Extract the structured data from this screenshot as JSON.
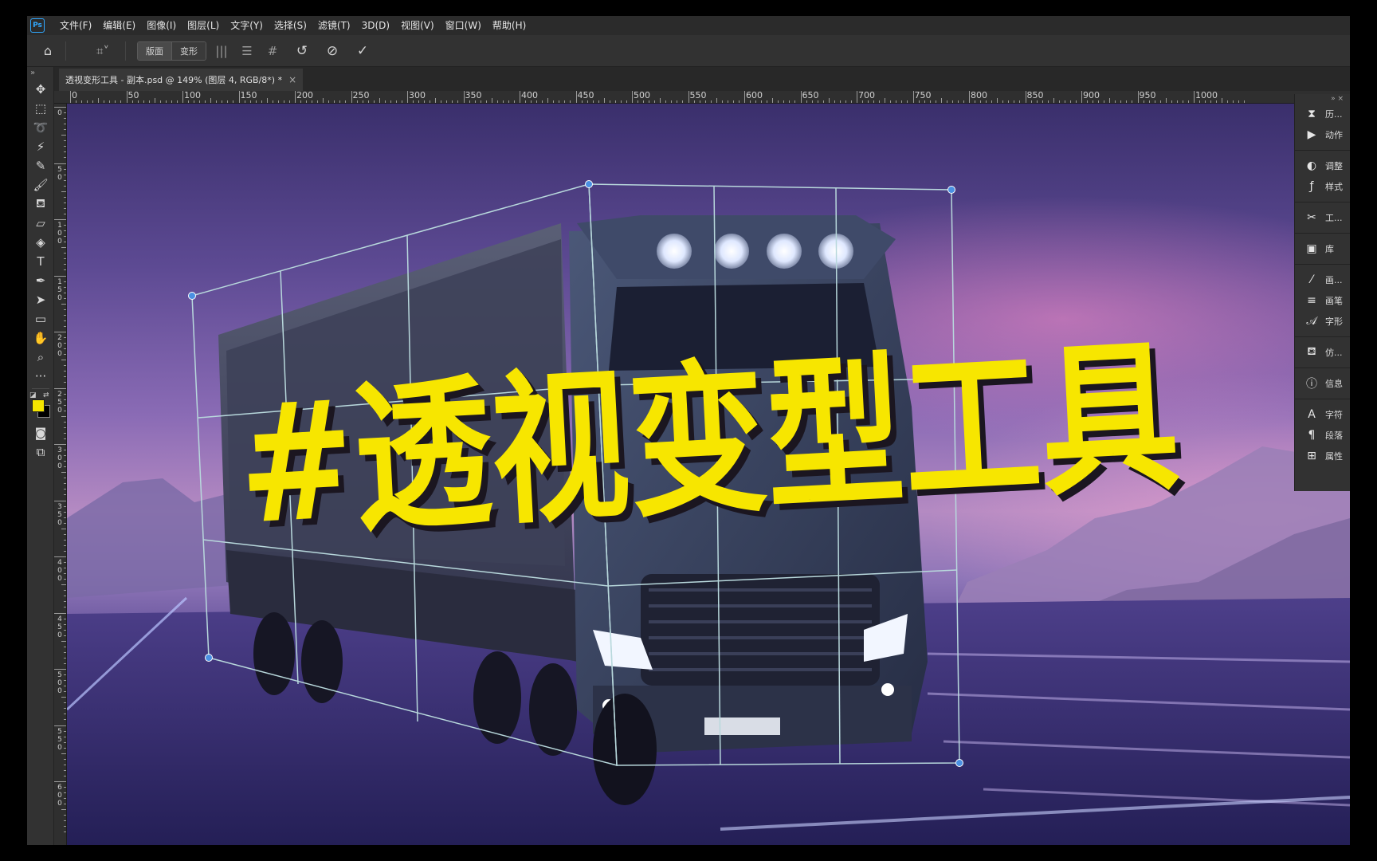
{
  "app": {
    "logo": "Ps"
  },
  "menu": [
    "文件(F)",
    "编辑(E)",
    "图像(I)",
    "图层(L)",
    "文字(Y)",
    "选择(S)",
    "滤镜(T)",
    "3D(D)",
    "视图(V)",
    "窗口(W)",
    "帮助(H)"
  ],
  "options": {
    "mode_buttons": [
      "版面",
      "变形"
    ],
    "icons": [
      "home-icon",
      "perspective-warp-icon",
      "vertical-straighten-icon",
      "horizontal-straighten-icon",
      "grid-straighten-icon",
      "reset-icon",
      "cancel-icon",
      "commit-icon"
    ]
  },
  "document": {
    "tab_title": "透视变形工具 - 副本.psd @ 149% (图层 4, RGB/8*) *",
    "close": "×"
  },
  "toolbar": {
    "collapse": "»",
    "tools": [
      "move-tool-icon",
      "marquee-tool-icon",
      "lasso-tool-icon",
      "magic-wand-icon",
      "eyedropper-icon",
      "brush-icon",
      "clone-stamp-icon",
      "eraser-icon",
      "paint-bucket-icon",
      "type-tool-icon",
      "pen-tool-icon",
      "path-select-icon",
      "rectangle-tool-icon",
      "hand-tool-icon",
      "zoom-tool-icon",
      "more-tools-icon"
    ],
    "foreground_color": "#f5e500",
    "background_color": "#000000"
  },
  "rulers": {
    "top": [
      "0",
      "50",
      "100",
      "150",
      "200",
      "250",
      "300",
      "350",
      "400",
      "450",
      "500",
      "550",
      "600",
      "650",
      "700",
      "750",
      "800",
      "850",
      "900",
      "950",
      "1000"
    ],
    "left": [
      "0",
      "50",
      "100",
      "150",
      "200",
      "250",
      "300",
      "350",
      "400",
      "450",
      "500",
      "550",
      "600"
    ]
  },
  "canvas": {
    "headline": "#透视变型工具",
    "headline_color": "#f7e600",
    "grid_color": "#b8d8dc",
    "handle_color": "#4a90e2"
  },
  "right_panel": {
    "collapse": "»",
    "close": "×",
    "groups": [
      [
        {
          "icon": "history-icon",
          "label": "历..."
        },
        {
          "icon": "actions-icon",
          "label": "动作"
        }
      ],
      [
        {
          "icon": "adjustments-icon",
          "label": "调整"
        },
        {
          "icon": "styles-icon",
          "label": "样式"
        }
      ],
      [
        {
          "icon": "tools-icon",
          "label": "工..."
        }
      ],
      [
        {
          "icon": "libraries-icon",
          "label": "库"
        }
      ],
      [
        {
          "icon": "brush-settings-icon",
          "label": "画..."
        },
        {
          "icon": "brushes-icon",
          "label": "画笔"
        },
        {
          "icon": "glyphs-icon",
          "label": "字形"
        }
      ],
      [
        {
          "icon": "clone-source-icon",
          "label": "仿..."
        }
      ],
      [
        {
          "icon": "info-icon",
          "label": "信息"
        }
      ],
      [
        {
          "icon": "character-icon",
          "label": "字符"
        },
        {
          "icon": "paragraph-icon",
          "label": "段落"
        },
        {
          "icon": "properties-icon",
          "label": "属性"
        }
      ]
    ]
  }
}
